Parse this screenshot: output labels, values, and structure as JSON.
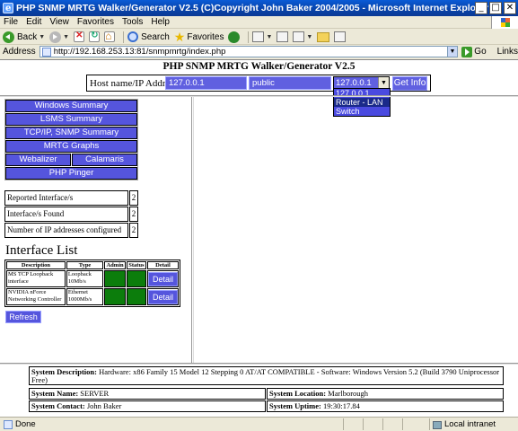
{
  "window": {
    "title": "PHP SNMP MRTG Walker/Generator V2.5 (C)Copyright John Baker 2004/2005 - Microsoft Internet Explorer",
    "buttons": {
      "minimize": "_",
      "maximize": "□",
      "close": "✕"
    }
  },
  "menu": [
    "File",
    "Edit",
    "View",
    "Favorites",
    "Tools",
    "Help"
  ],
  "toolbar": {
    "back": "Back",
    "search": "Search",
    "favorites": "Favorites"
  },
  "address": {
    "label": "Address",
    "url": "http://192.168.253.13:81/snmpmrtg/index.php",
    "go": "Go",
    "links": "Links"
  },
  "app": {
    "title": "PHP SNMP MRTG Walker/Generator V2.5",
    "host_label": "Host name/IP Address",
    "host_value": "127.0.0.1",
    "community_value": "public",
    "select_value": "127.0.0.1",
    "get_info": "Get Info",
    "dropdown_options": [
      "127.0.0.1",
      "Router - LAN",
      "Switch"
    ],
    "dropdown_highlighted": "Router - LAN"
  },
  "nav": {
    "windows_summary": "Windows Summary",
    "lsms_summary": "LSMS Summary",
    "tcpip_summary": "TCP/IP, SNMP Summary",
    "mrtg_graphs": "MRTG Graphs",
    "webalizer": "Webalizer",
    "calamaris": "Calamaris",
    "php_pinger": "PHP Pinger"
  },
  "info": [
    {
      "label": "Reported Interface/s",
      "value": "2"
    },
    {
      "label": "Interface/s Found",
      "value": "2"
    },
    {
      "label": "Number of IP addresses configured",
      "value": "2"
    }
  ],
  "interface_list": {
    "title": "Interface List",
    "headers": [
      "Description",
      "Type",
      "Admin",
      "Status",
      "Detail"
    ],
    "rows": [
      {
        "description": "MS TCP Loopback interface",
        "type": "Loopback 10Mb/s",
        "detail": "Detail"
      },
      {
        "description": "NVIDIA nForce Networking Controller",
        "type": "Ethernet 1000Mb/s",
        "detail": "Detail"
      }
    ],
    "refresh": "Refresh"
  },
  "system": {
    "description_label": "System Description:",
    "description_value": " Hardware: x86 Family 15 Model 12 Stepping 0 AT/AT COMPATIBLE - Software: Windows Version 5.2 (Build 3790 Uniprocessor Free)",
    "name_label": "System Name:",
    "name_value": " SERVER",
    "location_label": "System Location:",
    "location_value": " Marlborough",
    "contact_label": "System Contact:",
    "contact_value": " John Baker",
    "uptime_label": "System Uptime:",
    "uptime_value": " 19:30:17.84"
  },
  "status": {
    "text": "Done",
    "zone": "Local intranet"
  },
  "colors": {
    "button_blue": "#5555dd",
    "input_blue": "#6060e0",
    "status_green": "#0c7d0c",
    "titlebar": "#0a4fc4"
  }
}
